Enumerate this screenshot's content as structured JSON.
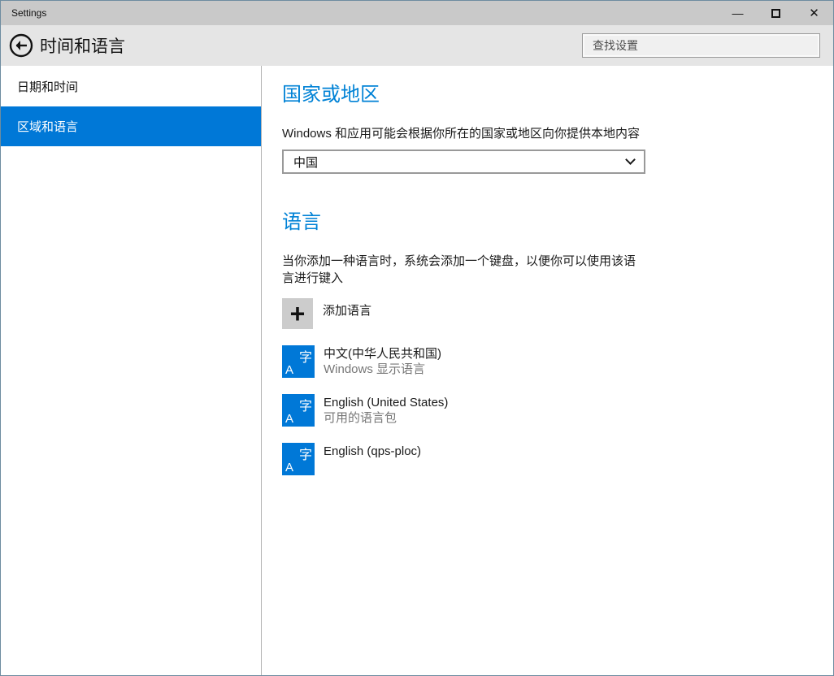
{
  "window": {
    "title": "Settings",
    "controls": {
      "minimize_glyph": "—",
      "close_glyph": "✕"
    }
  },
  "header": {
    "title": "时间和语言",
    "search": {
      "placeholder": "查找设置"
    }
  },
  "sidebar": {
    "items": [
      {
        "label": "日期和时间",
        "selected": false
      },
      {
        "label": "区域和语言",
        "selected": true
      }
    ]
  },
  "main": {
    "region_section": {
      "heading": "国家或地区",
      "description": "Windows 和应用可能会根据你所在的国家或地区向你提供本地内容",
      "dropdown": {
        "value": "中国"
      }
    },
    "language_section": {
      "heading": "语言",
      "description": "当你添加一种语言时，系统会添加一个键盘，以便你可以使用该语言进行键入",
      "add_button": {
        "label": "添加语言",
        "icon": "+"
      },
      "tile_glyphs": {
        "a": "A",
        "zi": "字"
      },
      "languages": [
        {
          "title": "中文(中华人民共和国)",
          "subtitle": "Windows 显示语言"
        },
        {
          "title": "English (United States)",
          "subtitle": "可用的语言包"
        },
        {
          "title": "English (qps-ploc)",
          "subtitle": ""
        }
      ]
    }
  },
  "colors": {
    "accent": "#0078d7",
    "heading_blue": "#0082d6",
    "titlebar_bg": "#c9c9c9",
    "header_bg": "#e5e5e5",
    "subtitle_gray": "#767676",
    "add_tile_gray": "#cccccc"
  }
}
